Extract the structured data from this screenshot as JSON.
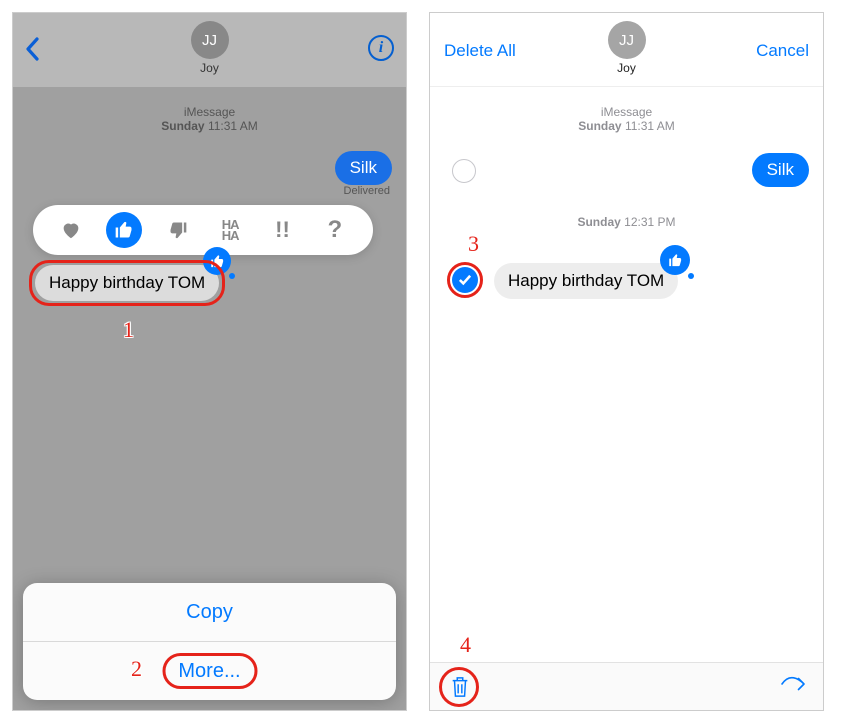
{
  "left": {
    "header": {
      "avatar_initials": "JJ",
      "contact_name": "Joy",
      "info_label": "i"
    },
    "meta": {
      "service": "iMessage",
      "day": "Sunday",
      "time": "11:31 AM"
    },
    "outgoing": {
      "text": "Silk",
      "status": "Delivered"
    },
    "tapback": {
      "haha": "HA\nHA",
      "exclaim": "!!",
      "question": "?"
    },
    "incoming": {
      "text": "Happy birthday TOM"
    },
    "sheet": {
      "copy": "Copy",
      "more": "More..."
    },
    "callouts": {
      "n1": "1",
      "n2": "2"
    }
  },
  "right": {
    "header": {
      "delete_all": "Delete All",
      "cancel": "Cancel",
      "avatar_initials": "JJ",
      "contact_name": "Joy"
    },
    "meta": {
      "service": "iMessage",
      "day": "Sunday",
      "time": "11:31 AM"
    },
    "outgoing": {
      "text": "Silk"
    },
    "meta2": {
      "day": "Sunday",
      "time": "12:31 PM"
    },
    "incoming": {
      "text": "Happy birthday TOM"
    },
    "callouts": {
      "n3": "3",
      "n4": "4"
    }
  }
}
